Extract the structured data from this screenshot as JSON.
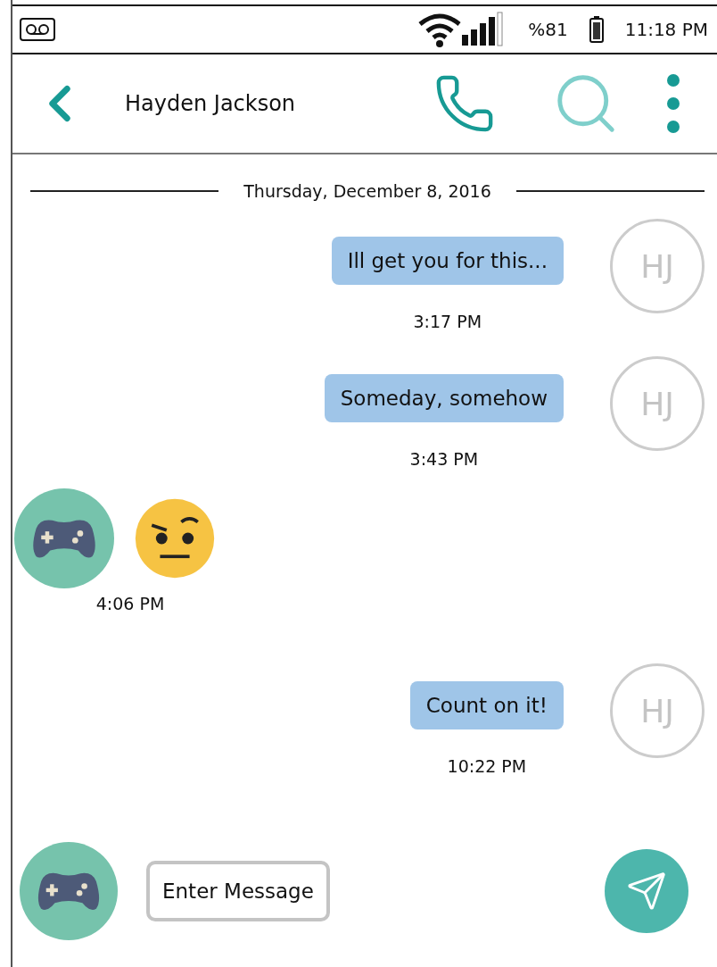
{
  "status_bar": {
    "battery_text": "%81",
    "time": "11:18 PM"
  },
  "header": {
    "contact_name": "Hayden Jackson"
  },
  "date_divider": "Thursday, December 8, 2016",
  "messages": [
    {
      "kind": "sent",
      "text": "Ill get you for this...",
      "time": "3:17 PM",
      "avatar": "HJ"
    },
    {
      "kind": "sent",
      "text": "Someday, somehow",
      "time": "3:43 PM",
      "avatar": "HJ"
    },
    {
      "kind": "emoji",
      "time": "4:06 PM"
    },
    {
      "kind": "sent",
      "text": "Count on it!",
      "time": "10:22 PM",
      "avatar": "HJ"
    }
  ],
  "composer": {
    "placeholder": "Enter Message"
  }
}
